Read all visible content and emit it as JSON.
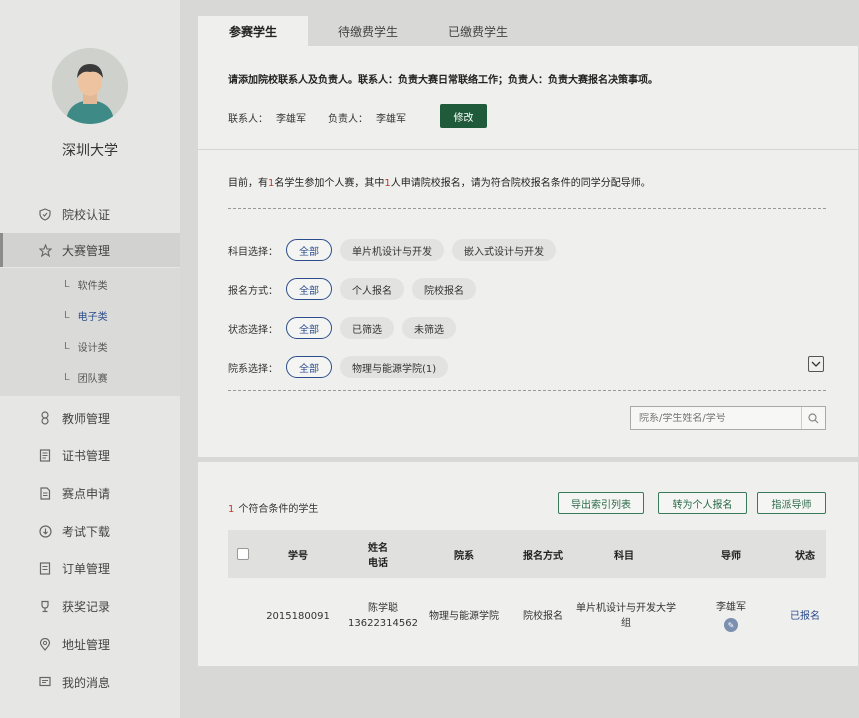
{
  "sidebar": {
    "school_name": "深圳大学",
    "items": [
      {
        "label": "院校认证",
        "icon": "shield-icon"
      },
      {
        "label": "大赛管理",
        "icon": "star-icon"
      },
      {
        "label": "教师管理",
        "icon": "teacher-icon"
      },
      {
        "label": "证书管理",
        "icon": "certificate-icon"
      },
      {
        "label": "赛点申请",
        "icon": "document-icon"
      },
      {
        "label": "考试下载",
        "icon": "download-icon"
      },
      {
        "label": "订单管理",
        "icon": "order-icon"
      },
      {
        "label": "获奖记录",
        "icon": "trophy-icon"
      },
      {
        "label": "地址管理",
        "icon": "location-icon"
      },
      {
        "label": "我的消息",
        "icon": "message-icon"
      }
    ],
    "sub_items": [
      {
        "prefix": "L",
        "label": "软件类"
      },
      {
        "prefix": "L",
        "label": "电子类"
      },
      {
        "prefix": "L",
        "label": "设计类"
      },
      {
        "prefix": "L",
        "label": "团队赛"
      }
    ]
  },
  "tabs": [
    "参赛学生",
    "待缴费学生",
    "已缴费学生"
  ],
  "contact": {
    "notice": "请添加院校联系人及负责人。联系人：负责大赛日常联络工作；负责人：负责大赛报名决策事项。",
    "contact_label": "联系人：",
    "contact_name": "李雄军",
    "owner_label": "负责人：",
    "owner_name": "李雄军",
    "edit_button": "修改"
  },
  "info": {
    "prefix": "目前，有",
    "count1": "1",
    "mid1": "名学生参加个人赛，其中",
    "count2": "1",
    "rest": "人申请院校报名，请为符合院校报名条件的同学分配导师。"
  },
  "filters": [
    {
      "label": "科目选择：",
      "options": [
        "全部",
        "单片机设计与开发",
        "嵌入式设计与开发"
      ]
    },
    {
      "label": "报名方式：",
      "options": [
        "全部",
        "个人报名",
        "院校报名"
      ]
    },
    {
      "label": "状态选择：",
      "options": [
        "全部",
        "已筛选",
        "未筛选"
      ]
    },
    {
      "label": "院系选择：",
      "options": [
        "全部",
        "物理与能源学院(1)"
      ]
    }
  ],
  "search": {
    "placeholder": "院系/学生姓名/学号"
  },
  "results": {
    "count": "1",
    "count_text": "个符合条件的学生",
    "buttons": [
      "导出索引列表",
      "转为个人报名",
      "指派导师"
    ]
  },
  "table": {
    "headers": [
      "学号",
      "姓名\n电话",
      "院系",
      "报名方式",
      "科目",
      "导师",
      "状态"
    ],
    "rows": [
      {
        "student_id": "2015180091",
        "name": "陈学聪",
        "phone": "13622314562",
        "department": "物理与能源学院",
        "method": "院校报名",
        "subject": "单片机设计与开发大学组",
        "mentor": "李雄军",
        "status": "已报名"
      }
    ]
  }
}
